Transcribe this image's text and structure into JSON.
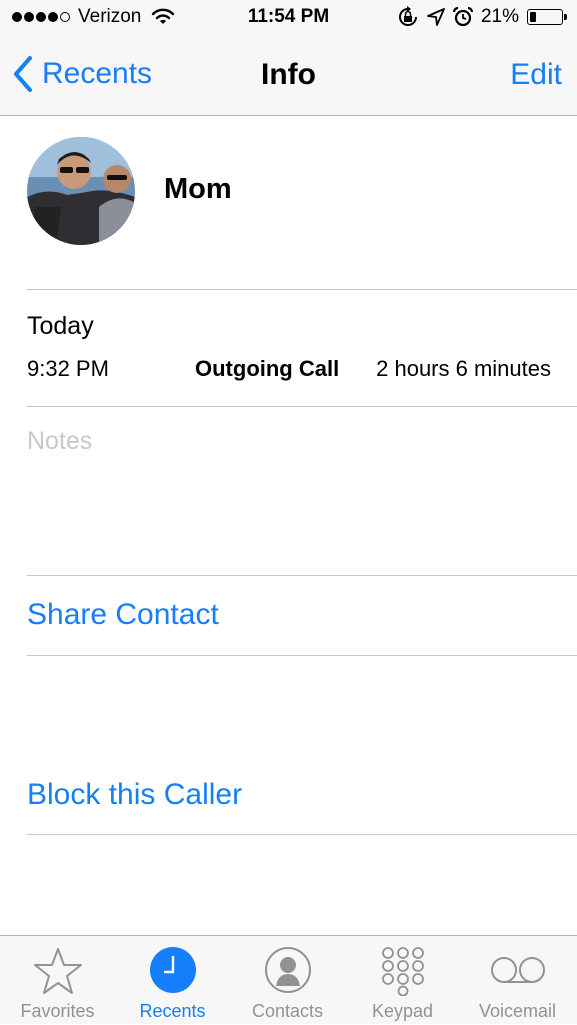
{
  "status_bar": {
    "carrier": "Verizon",
    "signal_bars": 4,
    "signal_total": 5,
    "time": "11:54 PM",
    "battery_percent": "21%",
    "battery_level": 0.21,
    "icons": [
      "wifi-icon",
      "rotation-lock-icon",
      "location-arrow-icon",
      "alarm-icon",
      "battery-icon"
    ]
  },
  "nav": {
    "back_label": "Recents",
    "title": "Info",
    "edit_label": "Edit"
  },
  "contact": {
    "name": "Mom"
  },
  "call_log": {
    "day": "Today",
    "entries": [
      {
        "time": "9:32 PM",
        "type": "Outgoing Call",
        "duration": "2 hours 6 minutes"
      }
    ]
  },
  "notes": {
    "placeholder": "Notes"
  },
  "actions": {
    "share_contact": "Share Contact",
    "block_caller": "Block this Caller"
  },
  "tabs": [
    {
      "label": "Favorites",
      "icon": "star-icon",
      "active": false
    },
    {
      "label": "Recents",
      "icon": "clock-icon",
      "active": true
    },
    {
      "label": "Contacts",
      "icon": "person-icon",
      "active": false
    },
    {
      "label": "Keypad",
      "icon": "keypad-icon",
      "active": false
    },
    {
      "label": "Voicemail",
      "icon": "voicemail-icon",
      "active": false
    }
  ],
  "colors": {
    "accent": "#157efb",
    "inactive_tab": "#929292",
    "placeholder": "#c7c7cd",
    "bar_background": "#f7f7f7"
  }
}
